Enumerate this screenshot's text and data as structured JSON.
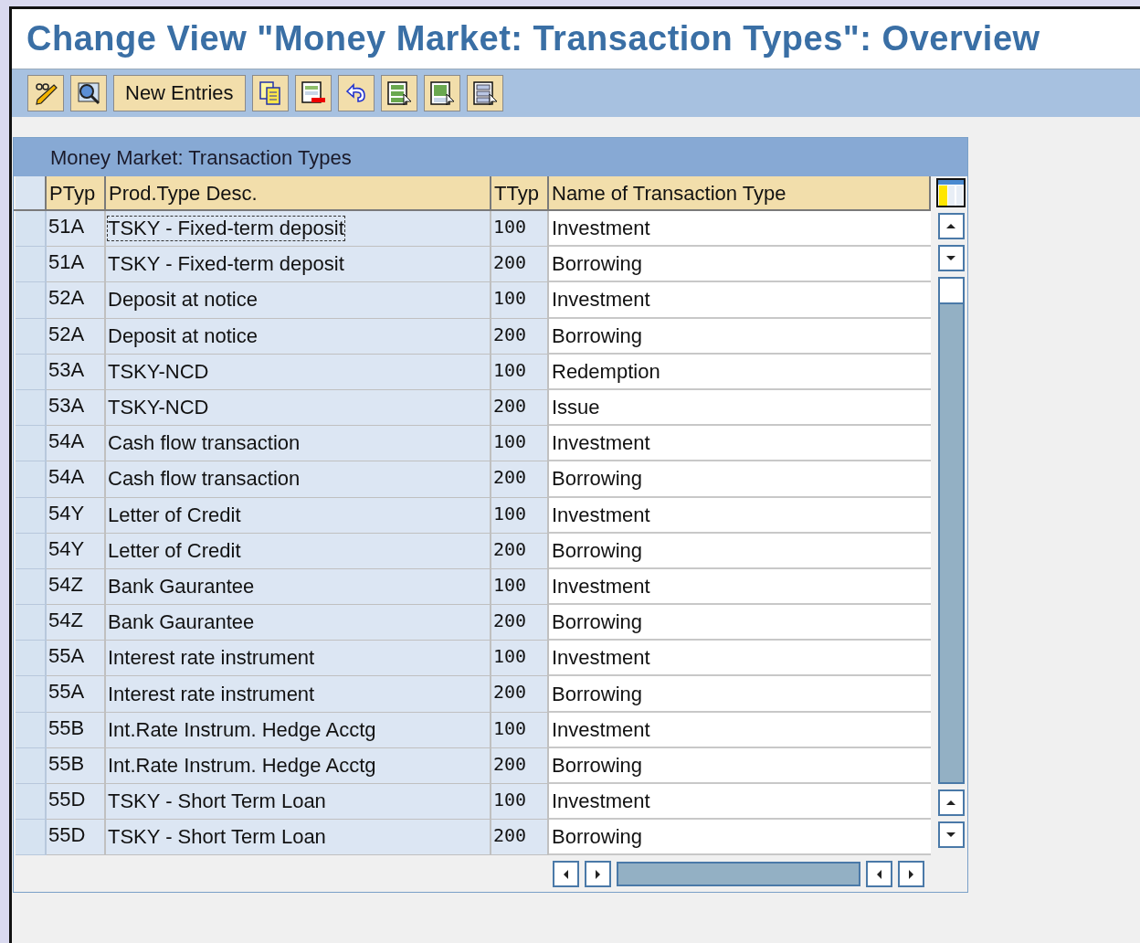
{
  "window": {
    "title": "Change View \"Money Market: Transaction Types\": Overview"
  },
  "toolbar": {
    "buttons": [
      {
        "kind": "icon"
      },
      {
        "kind": "icon"
      },
      {
        "kind": "text",
        "label": "New Entries"
      },
      {
        "kind": "icon"
      },
      {
        "kind": "icon"
      },
      {
        "kind": "icon"
      },
      {
        "kind": "icon"
      },
      {
        "kind": "icon"
      },
      {
        "kind": "icon"
      }
    ]
  },
  "table": {
    "title": "Money Market: Transaction Types",
    "columns": [
      "PTyp",
      "Prod.Type Desc.",
      "TTyp",
      "Name of Transaction Type"
    ],
    "rows": [
      {
        "ptyp": "51A",
        "desc": "TSKY - Fixed-term deposit",
        "ttyp": "100",
        "name": "Investment",
        "focused": true
      },
      {
        "ptyp": "51A",
        "desc": "TSKY - Fixed-term deposit",
        "ttyp": "200",
        "name": "Borrowing",
        "focused": false
      },
      {
        "ptyp": "52A",
        "desc": "Deposit at notice",
        "ttyp": "100",
        "name": "Investment",
        "focused": false
      },
      {
        "ptyp": "52A",
        "desc": "Deposit at notice",
        "ttyp": "200",
        "name": "Borrowing",
        "focused": false
      },
      {
        "ptyp": "53A",
        "desc": "TSKY-NCD",
        "ttyp": "100",
        "name": "Redemption",
        "focused": false
      },
      {
        "ptyp": "53A",
        "desc": "TSKY-NCD",
        "ttyp": "200",
        "name": "Issue",
        "focused": false
      },
      {
        "ptyp": "54A",
        "desc": "Cash flow transaction",
        "ttyp": "100",
        "name": "Investment",
        "focused": false
      },
      {
        "ptyp": "54A",
        "desc": "Cash flow transaction",
        "ttyp": "200",
        "name": "Borrowing",
        "focused": false
      },
      {
        "ptyp": "54Y",
        "desc": "Letter of Credit",
        "ttyp": "100",
        "name": "Investment",
        "focused": false
      },
      {
        "ptyp": "54Y",
        "desc": "Letter of Credit",
        "ttyp": "200",
        "name": "Borrowing",
        "focused": false
      },
      {
        "ptyp": "54Z",
        "desc": "Bank Gaurantee",
        "ttyp": "100",
        "name": "Investment",
        "focused": false
      },
      {
        "ptyp": "54Z",
        "desc": "Bank Gaurantee",
        "ttyp": "200",
        "name": "Borrowing",
        "focused": false
      },
      {
        "ptyp": "55A",
        "desc": "Interest rate instrument",
        "ttyp": "100",
        "name": "Investment",
        "focused": false
      },
      {
        "ptyp": "55A",
        "desc": "Interest rate instrument",
        "ttyp": "200",
        "name": "Borrowing",
        "focused": false
      },
      {
        "ptyp": "55B",
        "desc": "Int.Rate Instrum. Hedge Acctg",
        "ttyp": "100",
        "name": "Investment",
        "focused": false
      },
      {
        "ptyp": "55B",
        "desc": "Int.Rate Instrum. Hedge Acctg",
        "ttyp": "200",
        "name": "Borrowing",
        "focused": false
      },
      {
        "ptyp": "55D",
        "desc": "TSKY - Short Term Loan",
        "ttyp": "100",
        "name": "Investment",
        "focused": false
      },
      {
        "ptyp": "55D",
        "desc": "TSKY - Short Term Loan",
        "ttyp": "200",
        "name": "Borrowing",
        "focused": false
      }
    ]
  }
}
